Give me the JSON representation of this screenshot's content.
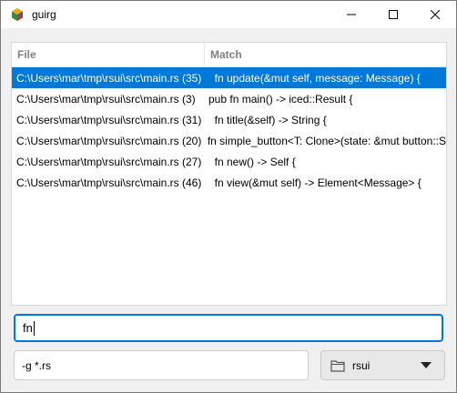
{
  "window": {
    "title": "guirg"
  },
  "table": {
    "headers": {
      "file": "File",
      "match": "Match"
    },
    "rows": [
      {
        "file": "C:\\Users\\mar\\tmp\\rsui\\src\\main.rs (35)",
        "match": "  fn update(&mut self, message: Message) {",
        "selected": true
      },
      {
        "file": "C:\\Users\\mar\\tmp\\rsui\\src\\main.rs (3)",
        "match": "pub fn main() -> iced::Result {",
        "selected": false
      },
      {
        "file": "C:\\Users\\mar\\tmp\\rsui\\src\\main.rs (31)",
        "match": "  fn title(&self) -> String {",
        "selected": false
      },
      {
        "file": "C:\\Users\\mar\\tmp\\rsui\\src\\main.rs (20)",
        "match": "fn simple_button<T: Clone>(state: &mut button::S",
        "selected": false
      },
      {
        "file": "C:\\Users\\mar\\tmp\\rsui\\src\\main.rs (27)",
        "match": "  fn new() -> Self {",
        "selected": false
      },
      {
        "file": "C:\\Users\\mar\\tmp\\rsui\\src\\main.rs (46)",
        "match": "  fn view(&mut self) -> Element<Message> {",
        "selected": false
      }
    ]
  },
  "search": {
    "value": "fn"
  },
  "glob": {
    "value": "-g *.rs"
  },
  "directory": {
    "label": "rsui",
    "icon": "folder-icon"
  },
  "colors": {
    "selection": "#0078d7",
    "focus_border": "#0078d7"
  }
}
